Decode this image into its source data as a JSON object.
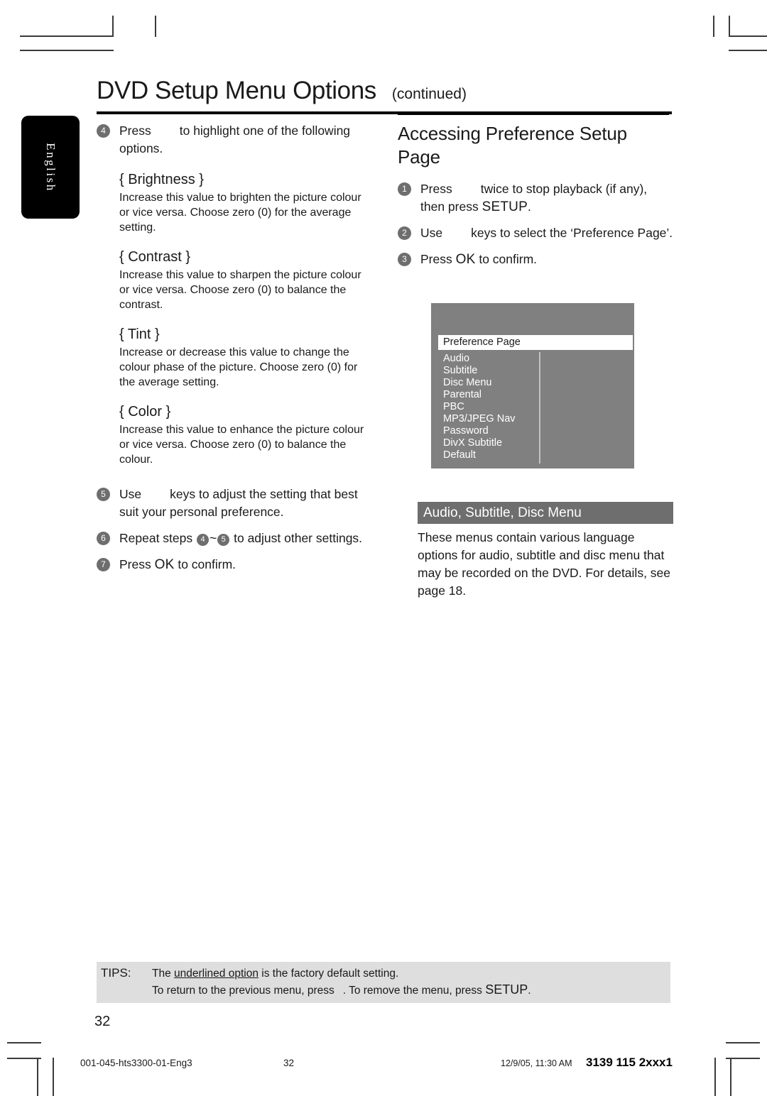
{
  "language_tab": {
    "label": "English"
  },
  "header": {
    "title": "DVD Setup Menu Options",
    "continued": "(continued)"
  },
  "left_column": {
    "step4": {
      "number": "4",
      "text_before": "Press",
      "text_after": "to highlight one of the following options."
    },
    "options": [
      {
        "title": "{ Brightness }",
        "body": "Increase this value to brighten the picture colour or vice versa. Choose zero (0) for the average setting."
      },
      {
        "title": "{ Contrast  }",
        "body": "Increase this value to sharpen the picture colour or vice versa.  Choose zero (0) to balance the contrast."
      },
      {
        "title": "{ Tint  }",
        "body": "Increase or decrease this value to change the colour phase of the picture.  Choose zero (0) for the average setting."
      },
      {
        "title": "{ Color  }",
        "body": "Increase this value to enhance the picture colour or vice versa. Choose zero (0) to balance the colour."
      }
    ],
    "step5": {
      "number": "5",
      "text_before": "Use",
      "text_after": "keys to adjust the setting that best suit your personal preference."
    },
    "step6": {
      "number": "6",
      "text_before": "Repeat steps",
      "ref_from": "4",
      "tilde": "~",
      "ref_to": "5",
      "text_after": "to adjust other settings."
    },
    "step7": {
      "number": "7",
      "text_before": "Press",
      "key": "OK",
      "text_after": "to confirm."
    }
  },
  "right_column": {
    "section_title": "Accessing Preference Setup Page",
    "step1": {
      "number": "1",
      "text_before": "Press",
      "text_mid": "twice to stop playback (if any), then press",
      "key": "SETUP",
      "text_after": "."
    },
    "step2": {
      "number": "2",
      "text_before": "Use",
      "text_after": "keys to select the ‘Preference Page’."
    },
    "step3": {
      "number": "3",
      "text_before": "Press",
      "key": "OK",
      "text_after": "to confirm."
    },
    "osd": {
      "title": "Preference Page",
      "items": [
        "Audio",
        "Subtitle",
        "Disc Menu",
        "Parental",
        "PBC",
        "MP3/JPEG Nav",
        "Password",
        "DivX Subtitle",
        "Default"
      ]
    },
    "subsection": {
      "heading": "Audio, Subtitle, Disc Menu",
      "body": "These menus contain various language options for audio, subtitle and disc menu that may be recorded on the DVD.  For details, see page 18."
    }
  },
  "tips": {
    "label": "TIPS:",
    "line1_before": "The",
    "line1_underlined": "underlined option",
    "line1_after": "is the factory default setting.",
    "line2_before": "To return to the previous menu, press",
    "line2_mid": ". To remove the menu, press",
    "line2_key": "SETUP",
    "line2_after": "."
  },
  "page_number": "32",
  "footer": {
    "file": "001-045-hts3300-01-Eng3",
    "page": "32",
    "date": "12/9/05, 11:30 AM",
    "code": "3139 115 2xxx1"
  },
  "colors": {
    "badge": "#6e6e6e",
    "osd_bg": "#808080",
    "subsection_bar": "#6e6e6e",
    "tips_bg": "#dedede"
  }
}
